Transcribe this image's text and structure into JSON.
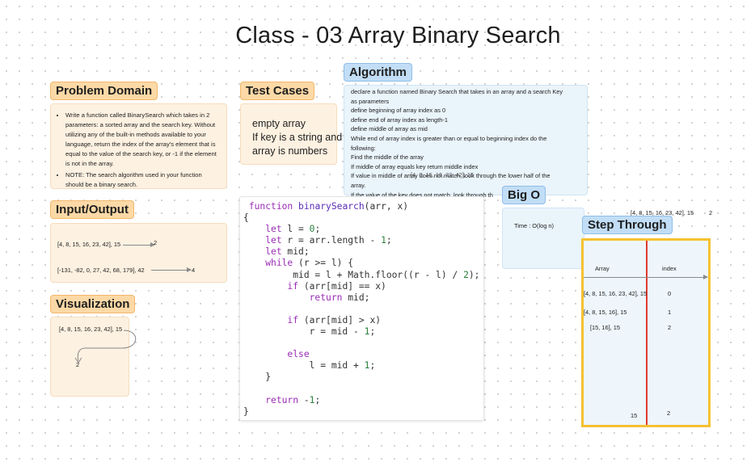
{
  "title": "Class - 03 Array Binary Search",
  "problem_domain": {
    "label": "Problem Domain",
    "bullets": [
      "Write a function called BinarySearch which takes in 2 parameters: a sorted array and the search key. Without utilizing any of the built-in methods available to your language, return the index of the array's element that is equal to the value of the search key, or -1 if the element is not in the array.",
      "NOTE: The search algorithm used in your function should be a binary search."
    ]
  },
  "test_cases": {
    "label": "Test Cases",
    "lines": [
      "empty array",
      "If key is a string and",
      "array is numbers"
    ]
  },
  "input_output": {
    "label": "Input/Output",
    "rows": [
      {
        "input": "[4, 8, 15, 16, 23, 42], 15",
        "output": "2"
      },
      {
        "input": "[-131, -82, 0, 27, 42, 68, 179], 42",
        "output": "4"
      }
    ]
  },
  "visualization": {
    "label": "Visualization",
    "input": "[4, 8, 15, 16, 23, 42], 15",
    "output": "2"
  },
  "algorithm": {
    "label": "Algorithm",
    "lines": [
      "declare a function named Binary Search that takes in an array and a search Key",
      "as  parameters",
      "define beginning of array index as 0",
      "define end of array index as length-1",
      "define middle of array as mid",
      "While end of array index is greater than or equal to beginning index do the",
      "following:",
      "Find the middle of the array",
      "If middle of array equals key return middle index",
      "If value in middle of array does not match, look through the lower half of the",
      "array.",
      "If the value of the key does not match, look through th"
    ],
    "overlap_text": "[4, 8, 15, 16, 23, 42], 15"
  },
  "code": {
    "lines": [
      " function binarySearch(arr, x)",
      "{",
      "    let l = 0;",
      "    let r = arr.length - 1;",
      "    let mid;",
      "    while (r >= l) {",
      "         mid = l + Math.floor((r - l) / 2);",
      "        if (arr[mid] == x)",
      "            return mid;",
      "",
      "        if (arr[mid] > x)",
      "            r = mid - 1;",
      "",
      "        else",
      "            l = mid + 1;",
      "    }",
      "",
      "    return -1;",
      "}"
    ]
  },
  "big_o": {
    "label": "Big O",
    "time": "Time : O(log n)"
  },
  "step_through": {
    "label": "Step Through",
    "header_input": "[4, 8, 15, 16, 23, 42], 15",
    "header_output": "2",
    "col_array": "Array",
    "col_index": "index",
    "rows": [
      {
        "array": "[4, 8, 15, 16, 23, 42], 15",
        "index": "0"
      },
      {
        "array": "[4, 8, 15, 16], 15",
        "index": "1"
      },
      {
        "array": "[15, 16], 15",
        "index": "2"
      }
    ],
    "result_value": "15",
    "result_index": "2"
  }
}
